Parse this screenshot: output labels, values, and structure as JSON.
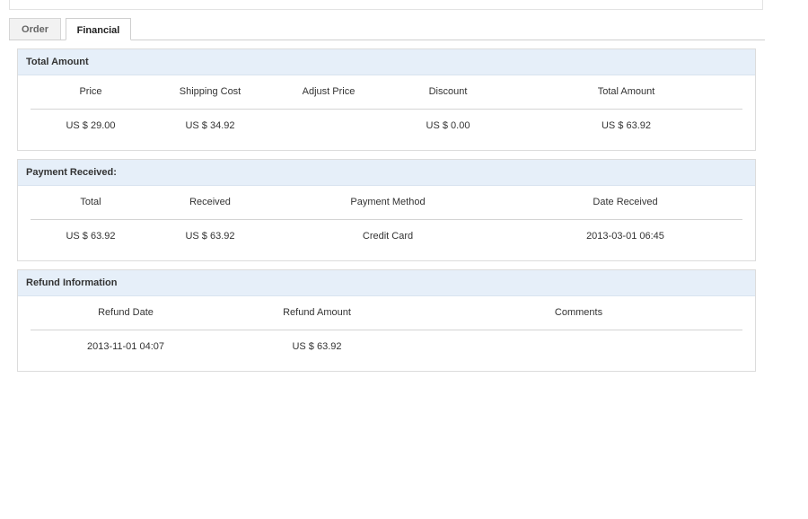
{
  "tabs": {
    "order_label": "Order",
    "financial_label": "Financial"
  },
  "total_amount": {
    "title": "Total Amount",
    "headers": [
      "Price",
      "Shipping Cost",
      "Adjust Price",
      "Discount",
      "Total Amount"
    ],
    "values": [
      "US $ 29.00",
      "US $ 34.92",
      "",
      "US $ 0.00",
      "US $ 63.92"
    ]
  },
  "payment_received": {
    "title": "Payment Received:",
    "headers": [
      "Total",
      "Received",
      "Payment Method",
      "Date Received"
    ],
    "values": [
      "US $ 63.92",
      "US $ 63.92",
      "Credit Card",
      "2013-03-01 06:45"
    ]
  },
  "refund_information": {
    "title": "Refund Information",
    "headers": [
      "Refund Date",
      "Refund Amount",
      "Comments"
    ],
    "values": [
      "2013-11-01 04:07",
      "US $ 63.92",
      ""
    ]
  }
}
